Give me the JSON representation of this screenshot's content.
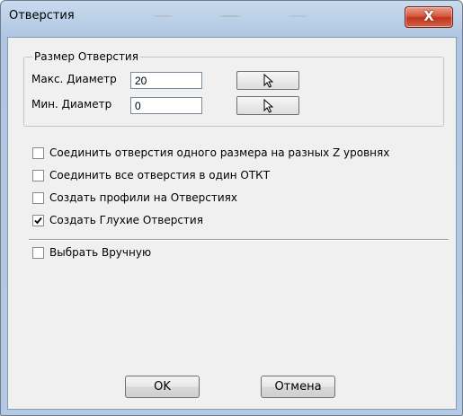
{
  "window": {
    "title": "Отверстия",
    "close_glyph": "X"
  },
  "group": {
    "legend": "Размер Отверстия",
    "max_label": "Макс. Диаметр",
    "max_value": "20",
    "min_label": "Мин. Диаметр",
    "min_value": "0",
    "pick_icon": "cursor-arrow-icon"
  },
  "options": [
    {
      "label": "Соединить отверстия одного размера на разных Z уровнях",
      "checked": false
    },
    {
      "label": "Соединить все отверстия в один ОТКТ",
      "checked": false
    },
    {
      "label": "Создать профили на Отверстиях",
      "checked": false
    },
    {
      "label": "Создать Глухие Отверстия",
      "checked": true
    }
  ],
  "manual": {
    "label": "Выбрать Вручную",
    "checked": false
  },
  "buttons": {
    "ok": "OK",
    "cancel": "Отмена"
  }
}
